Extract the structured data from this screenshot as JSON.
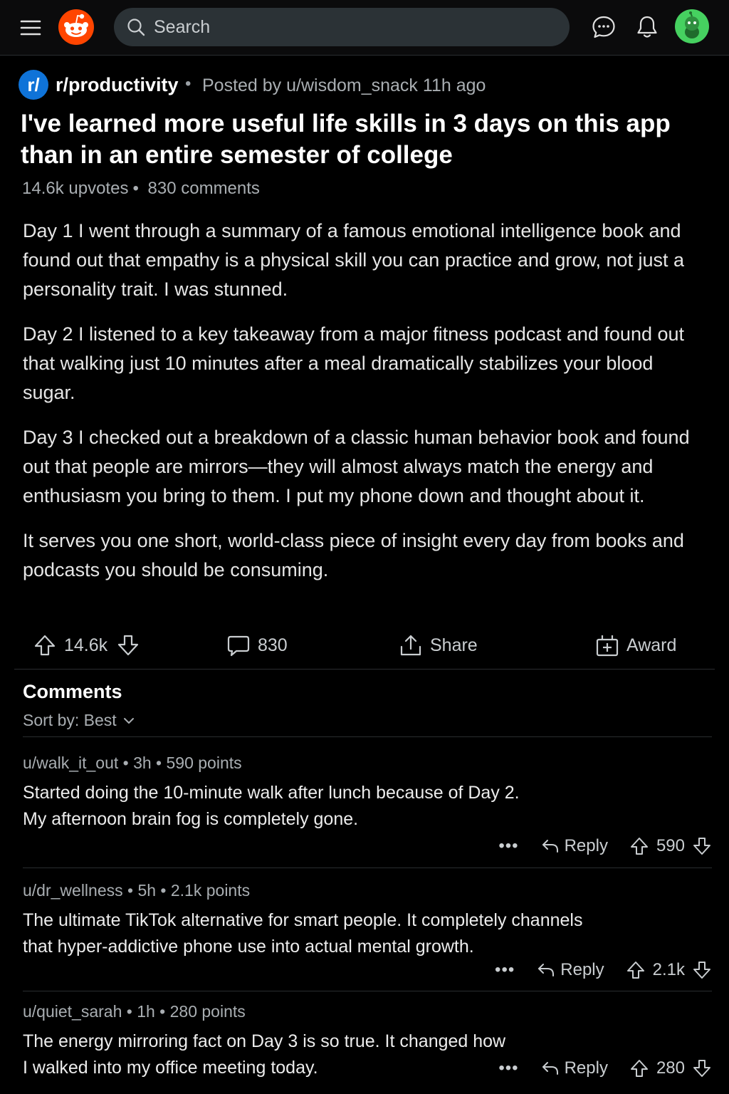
{
  "header": {
    "search_placeholder": "Search"
  },
  "post": {
    "subreddit": "r/productivity",
    "subreddit_icon_text": "r/",
    "posted_by": "Posted by u/wisdom_snack",
    "age": "11h ago",
    "title": "I've learned more useful life skills in 3 days on this app than in an entire semester of college",
    "upvotes": "14.6k upvotes",
    "comments": "830 comments",
    "paragraphs": [
      "Day 1 I went through a summary of a famous emotional intelligence book and found out that empathy is a physical skill you can practice and grow, not just a personality trait. I was stunned.",
      "Day 2 I listened to a key takeaway from a major fitness podcast and found out that walking just 10 minutes after a meal dramatically stabilizes your blood sugar.",
      "Day 3 I checked out a breakdown of a classic human behavior book and found out that people are mirrors—they will almost always match the energy and enthusiasm you bring to them. I put my phone down and thought about it.",
      "It serves you one short, world-class piece of insight every day from books and podcasts you should be consuming."
    ]
  },
  "actions": {
    "vote_count": "14.6k",
    "comment_count": "830",
    "share_label": "Share",
    "award_label": "Award"
  },
  "comments_section": {
    "heading": "Comments",
    "sort_label": "Sort by: Best",
    "items": [
      {
        "meta": "u/walk_it_out • 3h • 590 points",
        "text_line1": "Started doing the 10-minute walk after lunch because of Day 2.",
        "text_line2": "My afternoon brain fog is completely gone.",
        "reply_label": "Reply",
        "score": "590",
        "more": "•••"
      },
      {
        "meta": "u/dr_wellness • 5h • 2.1k points",
        "text_line1": "The ultimate TikTok alternative for smart people. It completely channels",
        "text_line2": "that hyper-addictive phone use into actual mental growth.",
        "reply_label": "Reply",
        "score": "2.1k",
        "more": "•••"
      },
      {
        "meta": "u/quiet_sarah • 1h • 280 points",
        "text_line1": "The energy mirroring fact on Day 3 is so true. It changed how",
        "text_line2": "I walked into my office meeting today.",
        "reply_label": "Reply",
        "score": "280",
        "more": "•••"
      }
    ]
  },
  "colors": {
    "background": "#000000",
    "reddit_orange": "#ff4500",
    "subreddit_blue": "#0f73d8",
    "avatar_green": "#46d160"
  }
}
